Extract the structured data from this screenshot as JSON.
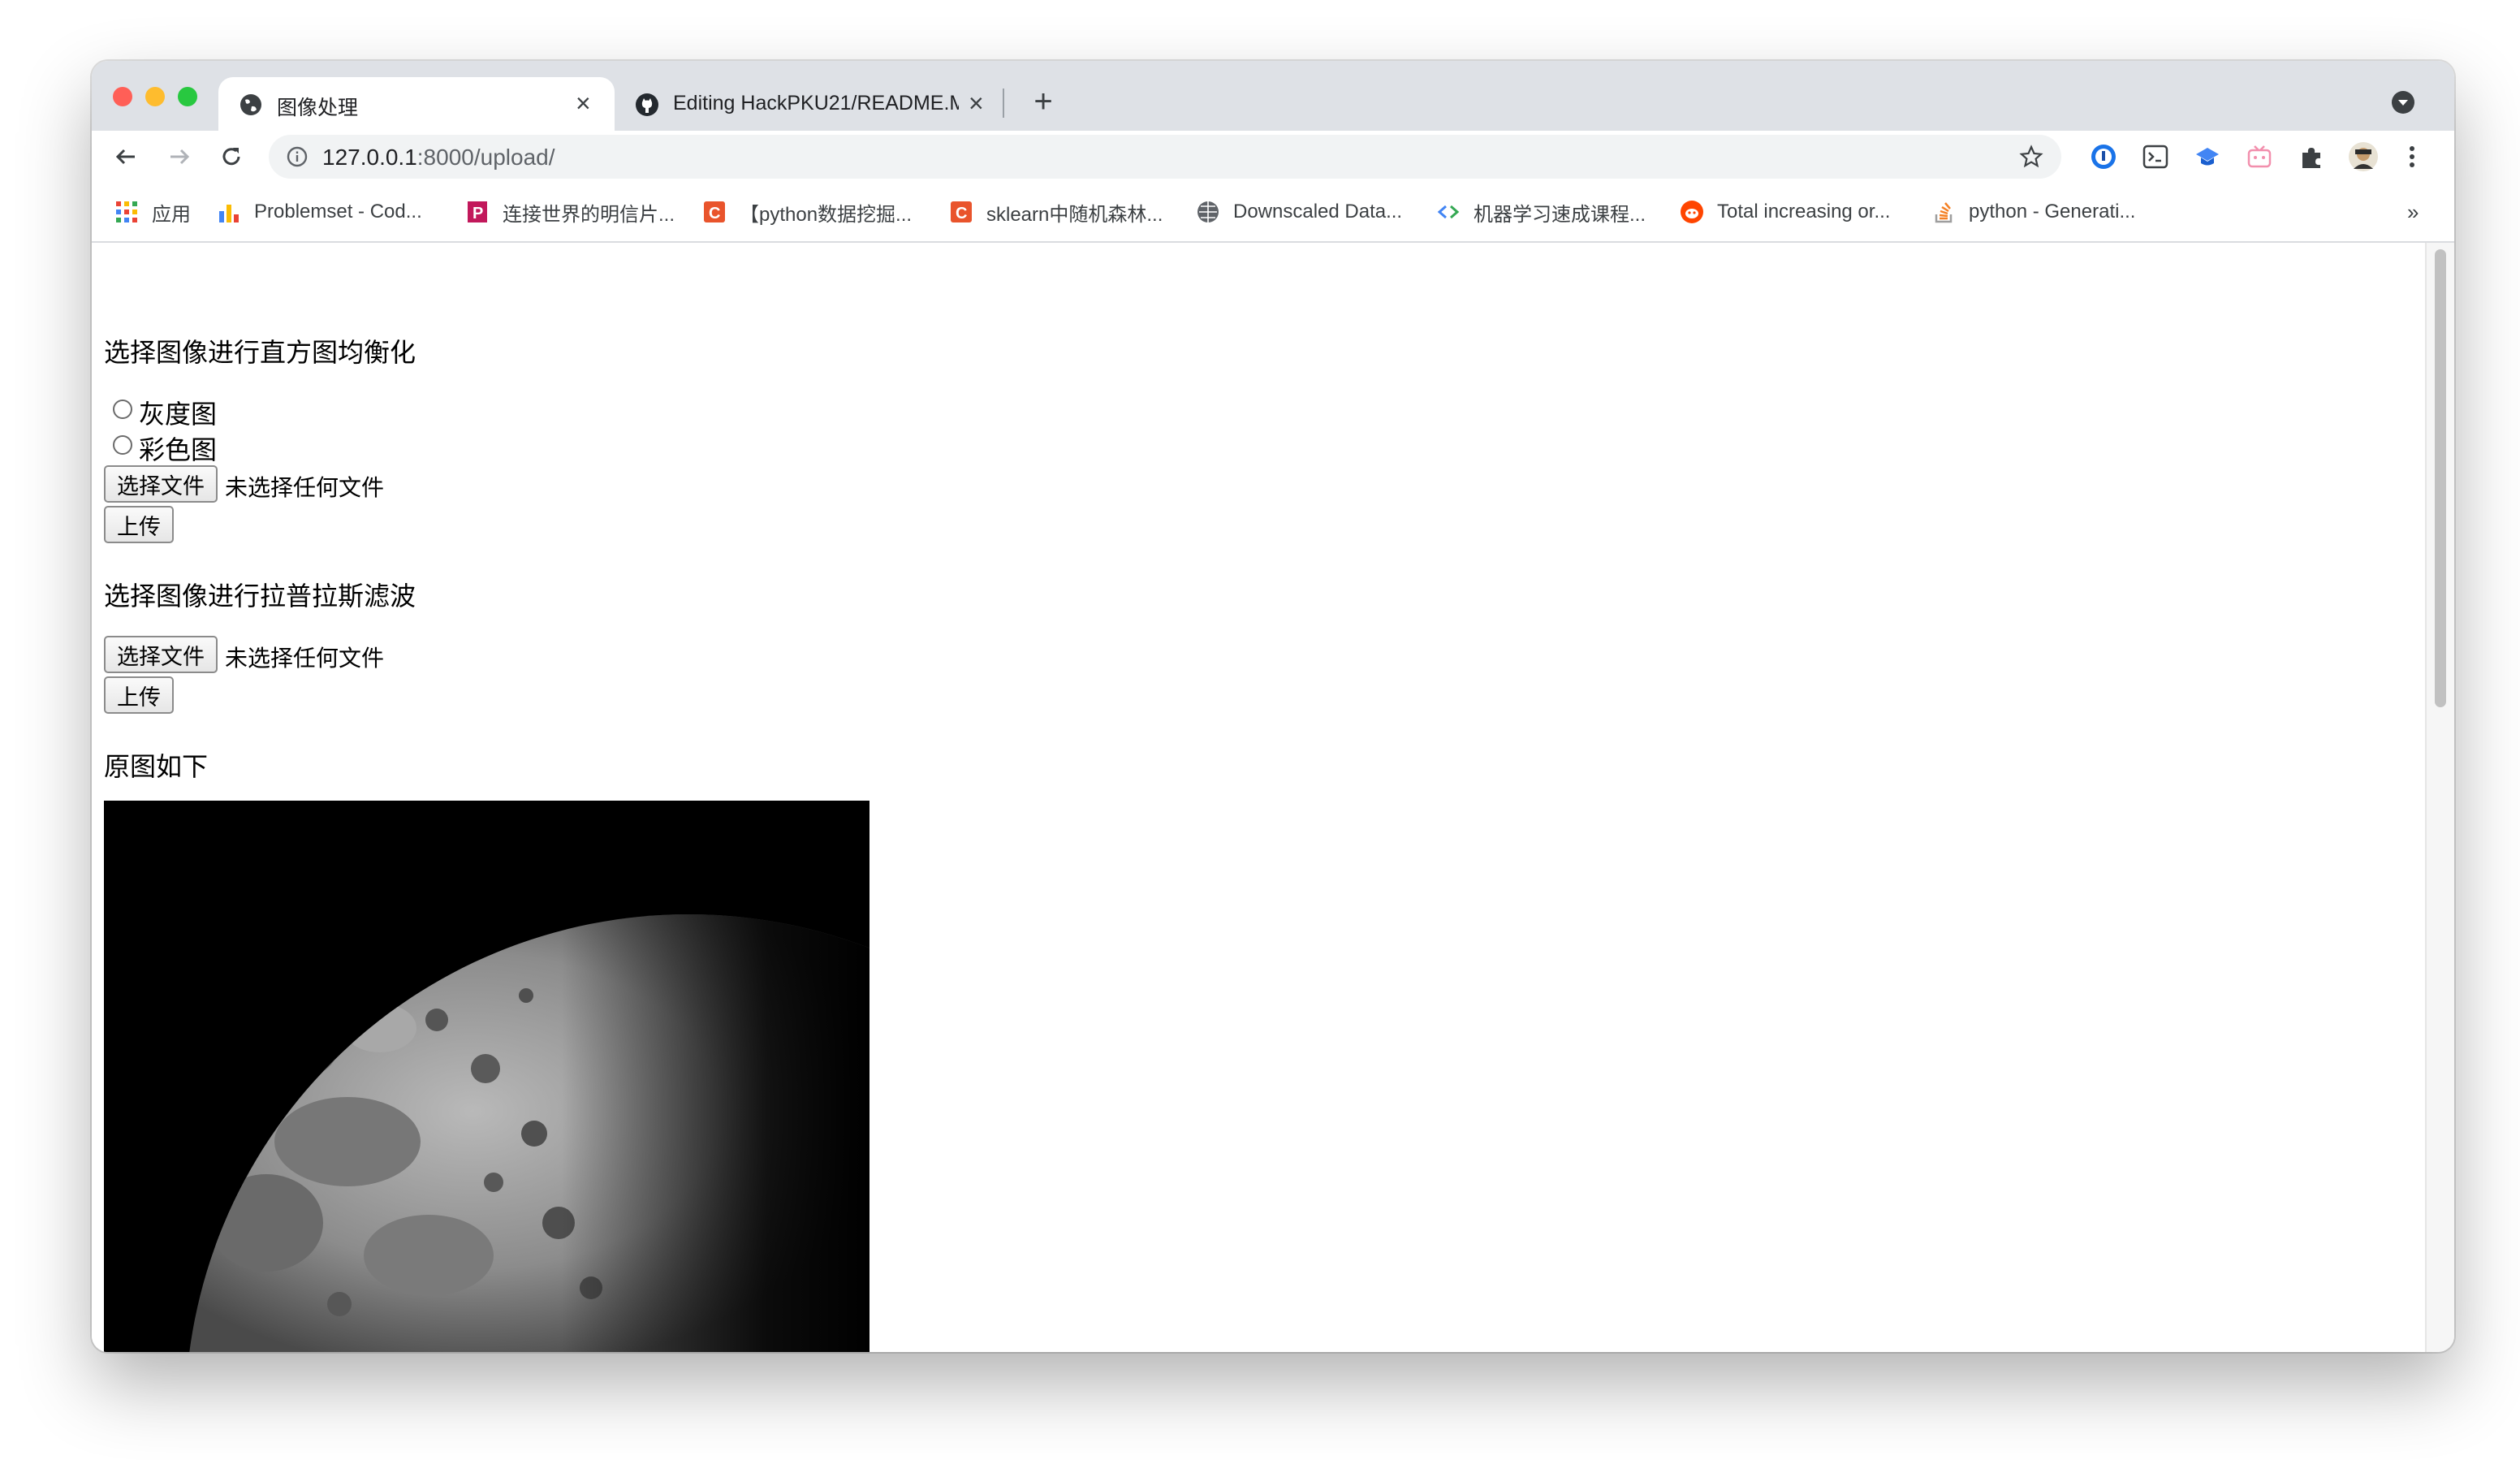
{
  "browser": {
    "tabs": [
      {
        "title": "图像处理",
        "icon": "globe-icon",
        "active": true
      },
      {
        "title": "Editing HackPKU21/README.M",
        "icon": "github-icon",
        "active": false
      }
    ],
    "new_tab_symbol": "+",
    "url_host": "127.0.0.1",
    "url_rest": ":8000/upload/",
    "bookmarks": [
      {
        "label": "应用",
        "icon": "apps-grid-icon"
      },
      {
        "label": "Problemset - Cod...",
        "icon": "bar-chart-icon"
      },
      {
        "label": "连接世界的明信片...",
        "icon": "postcard-icon"
      },
      {
        "label": "【python数据挖掘...",
        "icon": "csdn-icon"
      },
      {
        "label": "sklearn中随机森林...",
        "icon": "csdn-icon"
      },
      {
        "label": "Downscaled Data...",
        "icon": "globe-icon"
      },
      {
        "label": "机器学习速成课程...",
        "icon": "code-brackets-icon"
      },
      {
        "label": "Total increasing or...",
        "icon": "reddit-icon"
      },
      {
        "label": "python - Generati...",
        "icon": "stackoverflow-icon"
      }
    ],
    "bookmarks_overflow": "»"
  },
  "page": {
    "hist": {
      "title": "选择图像进行直方图均衡化",
      "options": [
        "灰度图",
        "彩色图"
      ],
      "choose_label": "选择文件",
      "no_file": "未选择任何文件",
      "upload_label": "上传"
    },
    "laplace": {
      "title": "选择图像进行拉普拉斯滤波",
      "choose_label": "选择文件",
      "no_file": "未选择任何文件",
      "upload_label": "上传"
    },
    "original_title": "原图如下",
    "image": "moon-photo"
  },
  "colors": {
    "tabstrip": "#dee1e6",
    "close_red": "#ff5f57",
    "minimize_yellow": "#febc2e",
    "zoom_green": "#28c840"
  }
}
